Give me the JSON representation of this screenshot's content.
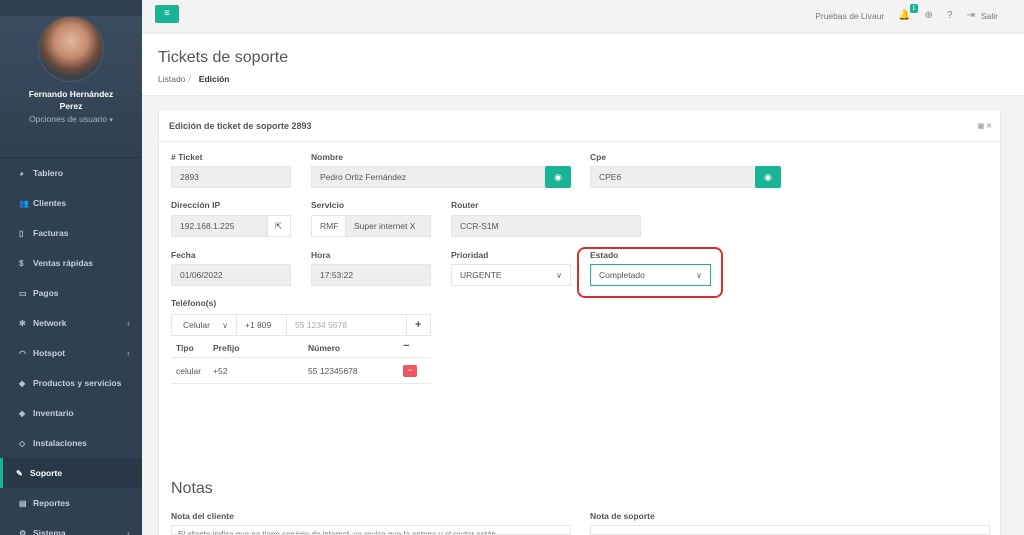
{
  "user": {
    "name_line1": "Fernando Hernández",
    "name_line2": "Perez",
    "options": "Opciones de usuario"
  },
  "sidebar": {
    "items": [
      {
        "label": "Tablero",
        "icon": "dashboard-icon",
        "glyph": "◕"
      },
      {
        "label": "Clientes",
        "icon": "users-icon",
        "glyph": "👥"
      },
      {
        "label": "Facturas",
        "icon": "file-icon",
        "glyph": "▯"
      },
      {
        "label": "Ventas rápidas",
        "icon": "dollar-icon",
        "glyph": "$"
      },
      {
        "label": "Pagos",
        "icon": "money-icon",
        "glyph": "▭"
      },
      {
        "label": "Network",
        "icon": "network-icon",
        "glyph": "✻",
        "chevron": "‹"
      },
      {
        "label": "Hotspot",
        "icon": "wifi-icon",
        "glyph": "◠",
        "chevron": "‹"
      },
      {
        "label": "Productos y servicios",
        "icon": "tags-icon",
        "glyph": "◆"
      },
      {
        "label": "Inventario",
        "icon": "cubes-icon",
        "glyph": "◈"
      },
      {
        "label": "Instalaciones",
        "icon": "tools-icon",
        "glyph": "◇"
      },
      {
        "label": "Soporte",
        "icon": "wrench-icon",
        "glyph": "✎",
        "active": true
      },
      {
        "label": "Reportes",
        "icon": "book-icon",
        "glyph": "▤"
      },
      {
        "label": "Sistema",
        "icon": "cogs-icon",
        "glyph": "⚙",
        "chevron": "‹"
      }
    ]
  },
  "topbar": {
    "menu_glyph": "≡",
    "brand": "Pruebas de Livaur",
    "notif_count": "1",
    "logout": "Salir"
  },
  "page": {
    "title": "Tickets de soporte",
    "breadcrumb_list": "Listado",
    "breadcrumb_sep": "/",
    "breadcrumb_current": "Edición"
  },
  "card": {
    "title": "Edición de ticket de soporte 2893",
    "tools": "▣ ✕"
  },
  "form": {
    "ticket_label": "# Ticket",
    "ticket_value": "2893",
    "nombre_label": "Nombre",
    "nombre_value": "Pedro Ortiz Fernández",
    "cpe_label": "Cpe",
    "cpe_value": "CPE6",
    "ip_label": "Dirección IP",
    "ip_value": "192.168.1.225",
    "servicio_label": "Servicio",
    "servicio_prefix": "RMF",
    "servicio_value": "Super internet X",
    "router_label": "Router",
    "router_value": "CCR-S1M",
    "fecha_label": "Fecha",
    "fecha_value": "01/06/2022",
    "hora_label": "Hora",
    "hora_value": "17:53:22",
    "prioridad_label": "Prioridad",
    "prioridad_value": "URGENTE",
    "estado_label": "Estado",
    "estado_value": "Completado",
    "telefono_label": "Teléfono(s)",
    "phone_type": "Celular",
    "phone_code": "+1 809",
    "phone_placeholder": "55 1234 5678",
    "eye_glyph": "◉",
    "ext_glyph": "⇱",
    "down_glyph": "∨",
    "plus_glyph": "+",
    "minus_glyph": "−"
  },
  "phones": {
    "headers": {
      "tipo": "Tipo",
      "prefijo": "Prefijo",
      "numero": "Número"
    },
    "rows": [
      {
        "tipo": "celular",
        "prefijo": "+52",
        "numero": "55 12345678"
      }
    ]
  },
  "notes": {
    "title": "Notas",
    "cliente_label": "Nota del cliente",
    "soporte_label": "Nota de soporte",
    "cliente_text": "El cliente indica que no tiene servicio de internet, ya reviso que la antena y el router están"
  }
}
